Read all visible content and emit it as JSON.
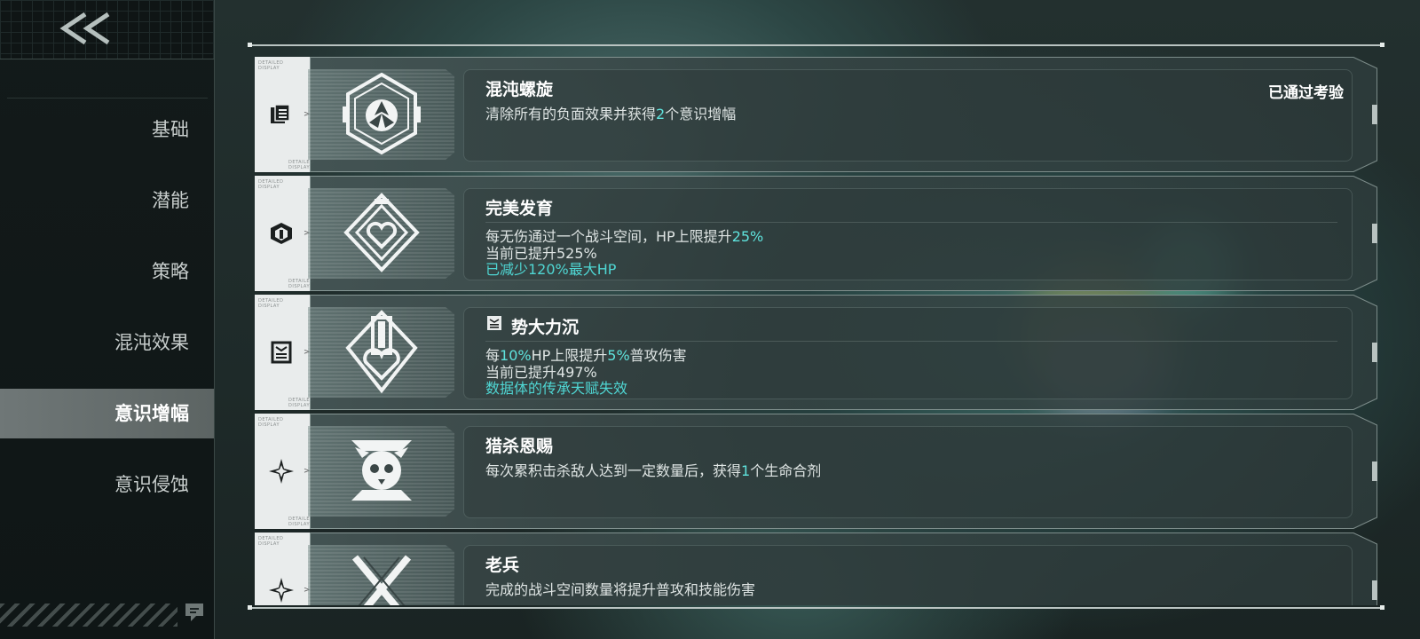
{
  "sidebar": {
    "back_label": "<<",
    "items": [
      {
        "label": "基础",
        "active": false
      },
      {
        "label": "潜能",
        "active": false
      },
      {
        "label": "策略",
        "active": false
      },
      {
        "label": "混沌效果",
        "active": false
      },
      {
        "label": "意识增幅",
        "active": true
      },
      {
        "label": "意识侵蚀",
        "active": false
      }
    ]
  },
  "side_tab_text": {
    "top": "DETAILED\nDISPLAY",
    "bottom": "DETAILED\nDISPLAY"
  },
  "cards": [
    {
      "title": "混沌螺旋",
      "status": "已通过考验",
      "desc1": {
        "pre": "清除所有的负面效果并获得",
        "hl": "2",
        "post": "个意识增幅"
      }
    },
    {
      "title": "完美发育",
      "desc1": {
        "pre": "每无伤通过一个战斗空间，HP上限提升",
        "hl": "25%"
      },
      "desc2": "当前已提升525%",
      "desc3": "已减少120%最大HP"
    },
    {
      "title": "势大力沉",
      "desc1": {
        "pre": "每",
        "hl1": "10%",
        "mid": "HP上限提升",
        "hl2": "5%",
        "post": "普攻伤害"
      },
      "desc2": "当前已提升497%",
      "desc3": "数据体的传承天赋失效"
    },
    {
      "title": "猎杀恩赐",
      "desc1": {
        "pre": "每次累积击杀敌人达到一定数量后，获得",
        "hl": "1",
        "post": "个生命合剂"
      }
    },
    {
      "title": "老兵",
      "desc1": "完成的战斗空间数量将提升普攻和技能伤害"
    }
  ],
  "colors": {
    "accent": "#5fe3dd",
    "sidebar_bg": "#131a1a",
    "active_tab": "#6f7777"
  },
  "icons": [
    "back-chevrons-icon",
    "helper-icon",
    "stack-cards-icon",
    "hex-helmet-icon",
    "box-face-icon",
    "star-burst-icon",
    "hex-emblem-icon",
    "diamond-heart-icon",
    "sword-heart-icon",
    "beast-skull-icon",
    "crossed-swords-icon"
  ]
}
